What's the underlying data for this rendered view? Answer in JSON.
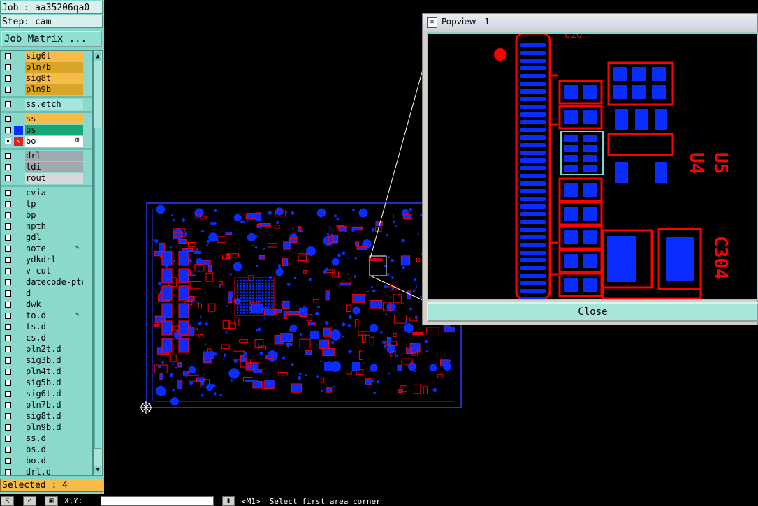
{
  "header": {
    "job": "Job : aa35206qa0",
    "step": "Step: cam",
    "job_matrix_button": "Job Matrix ..."
  },
  "layers": [
    {
      "name": "sig6t",
      "color": "#f7bb4a",
      "group": 0
    },
    {
      "name": "pln7b",
      "color": "#d8a52a",
      "group": 0
    },
    {
      "name": "sig8t",
      "color": "#f7bb4a",
      "group": 0
    },
    {
      "name": "pln9b",
      "color": "#d8a52a",
      "group": 0
    },
    {
      "name": "ss.etch",
      "color": "#a8e6dc",
      "group": 1
    },
    {
      "name": "ss",
      "color": "#f7bb4a",
      "group": 2
    },
    {
      "name": "bs",
      "color": "#14a878",
      "group": 2
    },
    {
      "name": "bo",
      "color": "#ffffff",
      "group": 2,
      "active": true
    },
    {
      "name": "drl",
      "color": "#a0a8b0",
      "group": 3
    },
    {
      "name": "ldi",
      "color": "#a0a8b0",
      "group": 3
    },
    {
      "name": "rout",
      "color": "#d8d8d8",
      "group": 3
    },
    {
      "name": "cvia",
      "color": "#8ad9cc",
      "group": 4
    },
    {
      "name": "tp",
      "color": "#8ad9cc",
      "group": 4
    },
    {
      "name": "bp",
      "color": "#8ad9cc",
      "group": 4
    },
    {
      "name": "npth",
      "color": "#8ad9cc",
      "group": 4
    },
    {
      "name": "gdl",
      "color": "#8ad9cc",
      "group": 4
    },
    {
      "name": "note",
      "color": "#8ad9cc",
      "group": 4,
      "edit": true
    },
    {
      "name": "ydkdrl",
      "color": "#8ad9cc",
      "group": 4
    },
    {
      "name": "v-cut",
      "color": "#8ad9cc",
      "group": 4
    },
    {
      "name": "datecode-pte",
      "color": "#8ad9cc",
      "group": 4
    },
    {
      "name": "d",
      "color": "#8ad9cc",
      "group": 4
    },
    {
      "name": "dwk",
      "color": "#8ad9cc",
      "group": 4
    },
    {
      "name": "to.d",
      "color": "#8ad9cc",
      "group": 4,
      "edit": true
    },
    {
      "name": "ts.d",
      "color": "#8ad9cc",
      "group": 4
    },
    {
      "name": "cs.d",
      "color": "#8ad9cc",
      "group": 4
    },
    {
      "name": "pln2t.d",
      "color": "#8ad9cc",
      "group": 4
    },
    {
      "name": "sig3b.d",
      "color": "#8ad9cc",
      "group": 4
    },
    {
      "name": "pln4t.d",
      "color": "#8ad9cc",
      "group": 4
    },
    {
      "name": "sig5b.d",
      "color": "#8ad9cc",
      "group": 4
    },
    {
      "name": "sig6t.d",
      "color": "#8ad9cc",
      "group": 4
    },
    {
      "name": "pln7b.d",
      "color": "#8ad9cc",
      "group": 4
    },
    {
      "name": "sig8t.d",
      "color": "#8ad9cc",
      "group": 4
    },
    {
      "name": "pln9b.d",
      "color": "#8ad9cc",
      "group": 4
    },
    {
      "name": "ss.d",
      "color": "#8ad9cc",
      "group": 4
    },
    {
      "name": "bs.d",
      "color": "#8ad9cc",
      "group": 4
    },
    {
      "name": "bo.d",
      "color": "#8ad9cc",
      "group": 4
    },
    {
      "name": "drl.d",
      "color": "#8ad9cc",
      "group": 4
    }
  ],
  "selected": "Selected : 4",
  "popview": {
    "title": "Popview - 1",
    "close_label": "Close",
    "silk_labels": [
      "U4",
      "U5",
      "C304"
    ]
  },
  "bottom": {
    "xy_label": "X,Y:",
    "coord_value": "",
    "mouse_button": "<M1>",
    "prompt": "Select first area corner"
  },
  "colors": {
    "pad_blue": "#0a2cff",
    "trace_red": "#ff0000",
    "panel_teal": "#7fd6c9",
    "selected_orange": "#f7bb4a"
  }
}
